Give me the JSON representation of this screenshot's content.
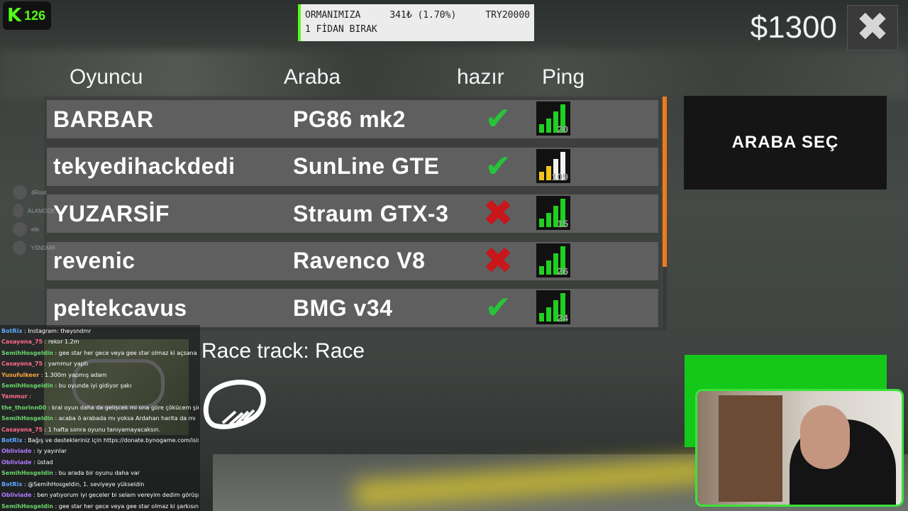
{
  "kick": {
    "badge": "126"
  },
  "donation": {
    "line1_left": "ORMANIMIZA",
    "line1_mid": "341₺ (1.70%)",
    "line1_right": "TRY20000",
    "line2": "1 FİDAN BIRAK"
  },
  "money": "$1300",
  "close_glyph": "✖",
  "headers": {
    "player": "Oyuncu",
    "car": "Araba",
    "ready": "hazır",
    "ping": "Ping"
  },
  "players": [
    {
      "name": "BARBAR",
      "car": "PG86 mk2",
      "ready": true,
      "ping": "20",
      "ping_level": 4
    },
    {
      "name": "tekyedihackdedi",
      "car": "SunLine GTE",
      "ready": true,
      "ping": "109",
      "ping_level": 2
    },
    {
      "name": "YUZARSİF",
      "car": "Straum GTX-3",
      "ready": false,
      "ping": "15",
      "ping_level": 4
    },
    {
      "name": "revenic",
      "car": "Ravenco V8",
      "ready": false,
      "ping": "26",
      "ping_level": 4
    },
    {
      "name": "peltekcavus",
      "car": "BMG v34",
      "ready": true,
      "ping": "24",
      "ping_level": 4
    }
  ],
  "ready_glyphs": {
    "yes": "✔",
    "no": "✖"
  },
  "select_car": "ARABA SEÇ",
  "track": "Race track: Race",
  "side_users": [
    "4Root",
    "ALAMODE",
    "efe",
    "YSNDMR"
  ],
  "chat": [
    {
      "user": "BotRix",
      "text": ": Instagram: theysndmr",
      "color": "#5aa9ff"
    },
    {
      "user": "Casayona_75",
      "text": ": rekor 1.2m",
      "color": "#ff6b8a"
    },
    {
      "user": "SemihHosgeldin",
      "text": ": gee star her gece veya gee star olmaz ki açsana",
      "color": "#6bd66b"
    },
    {
      "user": "Casayona_75",
      "text": ": yammur yaptı",
      "color": "#ff6b8a"
    },
    {
      "user": "Yusufulkeer",
      "text": ": 1.300m yapmış adam",
      "color": "#ffa53a"
    },
    {
      "user": "SemihHosgeldin",
      "text": ": bu oyunda iyi gidiyor şakı",
      "color": "#6bd66b"
    },
    {
      "user": "Yammur",
      "text": ":",
      "color": "#ff6b8a"
    },
    {
      "user": "the_thorinn00",
      "text": ": kral oyun daha da gelişcek mi ona göre çökücem şimdi",
      "color": "#6bd66b"
    },
    {
      "user": "SemihHosgeldin",
      "text": ": acaba ö arabada mı yoksa Ardahan harita da mı",
      "color": "#6bd66b"
    },
    {
      "user": "Casayona_75",
      "text": ": 1 hafta sonra oyunu tanıyamayacaksın.",
      "color": "#ff6b8a"
    },
    {
      "user": "BotRix",
      "text": ": Bağış ve destekleriniz için https://donate.bynogame.com/isis",
      "color": "#5aa9ff"
    },
    {
      "user": "Obliviade",
      "text": ": iy yayınlar",
      "color": "#b07aff"
    },
    {
      "user": "Obliviade",
      "text": ": üstad",
      "color": "#b07aff"
    },
    {
      "user": "SemihHosgeldin",
      "text": ": bu arada bir oyunu daha var",
      "color": "#6bd66b"
    },
    {
      "user": "BotRix",
      "text": ": @SemihHosgeldin, 1. seviyeye yükseldin",
      "color": "#5aa9ff"
    },
    {
      "user": "Obliviade",
      "text": ": ben yatıyorum iyi geceler bi selam vereyim dedim görüşmek",
      "color": "#b07aff"
    },
    {
      "user": "SemihHosgeldin",
      "text": ": gee star her gece veya gee star olmaz ki şarkısını açsar",
      "color": "#6bd66b"
    }
  ]
}
